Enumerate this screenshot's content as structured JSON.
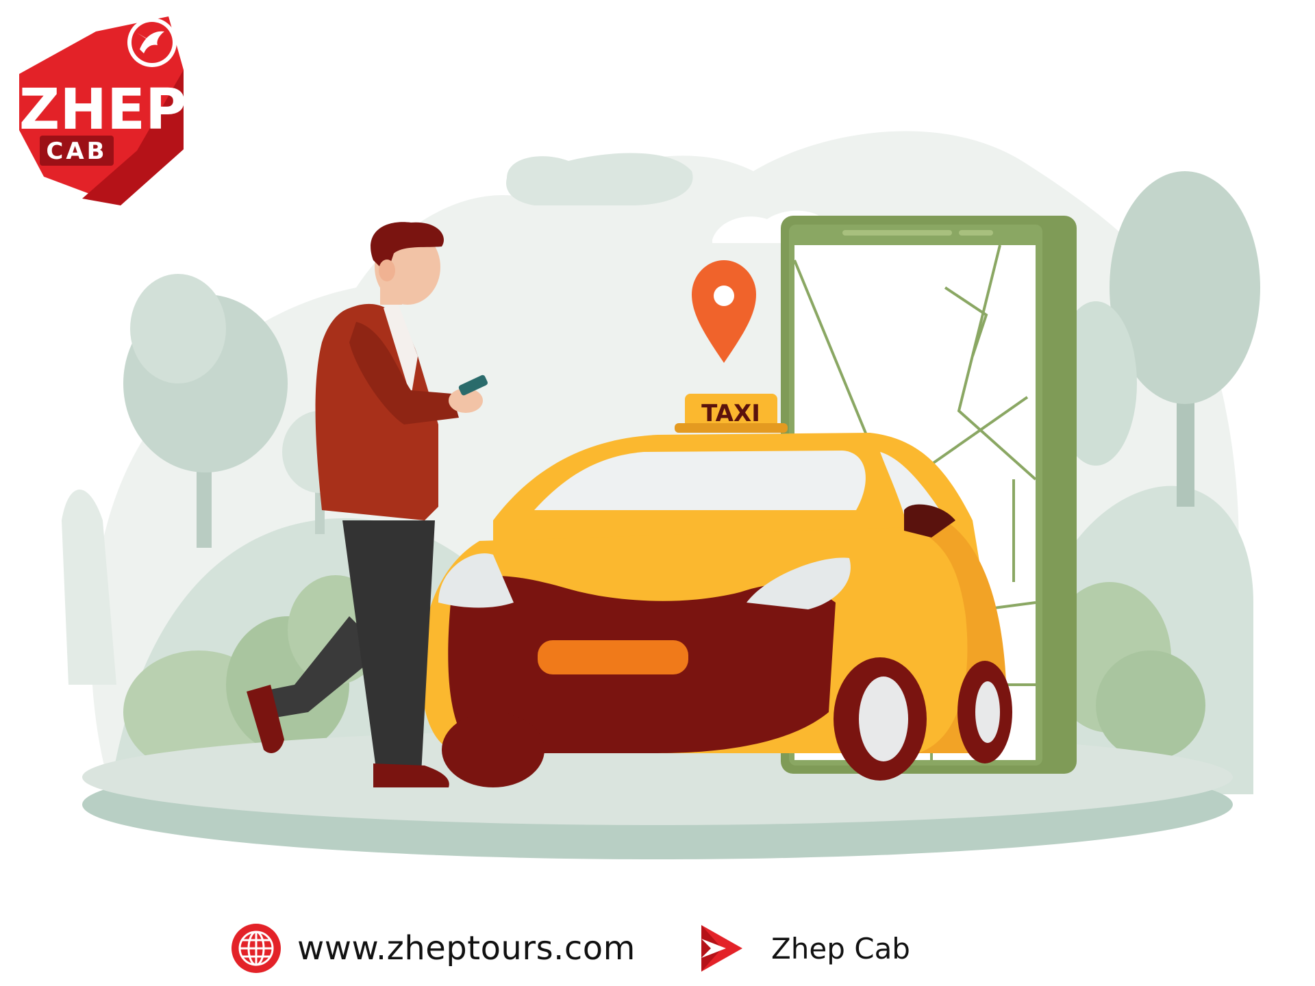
{
  "brand": {
    "logo_word": "ZHEP",
    "logo_sub": "CAB"
  },
  "taxi_sign": "TAXI",
  "footer": {
    "website": "www.zheptours.com",
    "channel": "Zhep Cab"
  },
  "colors": {
    "brand_red": "#e32228",
    "taxi_yellow": "#fbb82f",
    "car_dark": "#7a1410",
    "phone_green": "#7f9b57",
    "pin_orange": "#f0632b",
    "jacket": "#a8301a",
    "scenery": "#c9d8d0"
  },
  "icons": {
    "logo_bird": "bird-icon",
    "website": "globe-icon",
    "channel": "play-icon",
    "location": "map-pin-icon"
  }
}
